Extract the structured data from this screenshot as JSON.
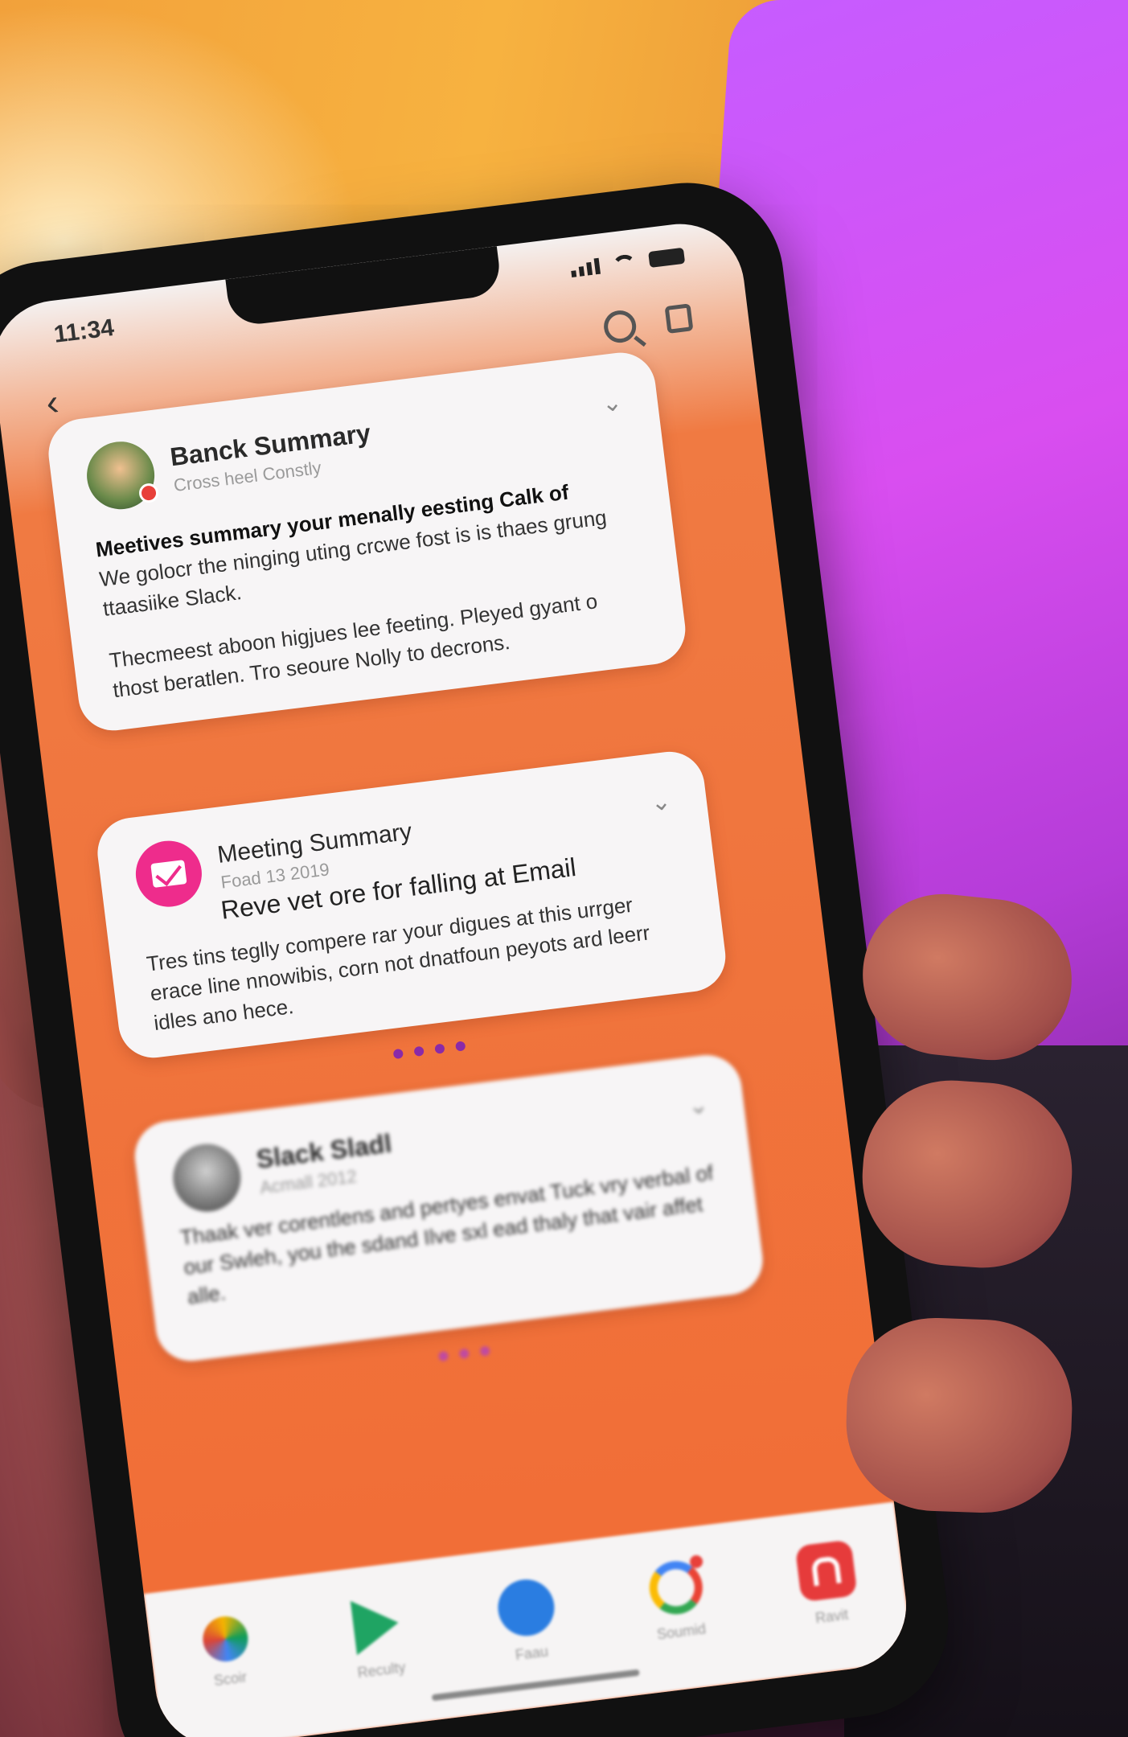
{
  "status_bar": {
    "time": "11:34"
  },
  "cards": [
    {
      "title": "Banck Summary",
      "subtitle": "Cross heel Constly",
      "body_bold": "Meetives summary your menally eesting Calk of",
      "body_lines_1": "We golocr the ninging uting crcwe fost is is thaes grung ttaasiike Slack.",
      "body_lines_2": "Thecmeest aboon higjues lee feeting. Pleyed gyant o thost beratlen. Tro seoure Nolly to decrons."
    },
    {
      "title": "Meeting Summary",
      "subtitle": "Foad 13 2019",
      "subject": "Reve vet ore for falling at Email",
      "body": "Tres tins teglly compere rar your digues at this urrger erace line nnowibis, corn not dnatfoun peyots ard leerr idles ano hece."
    },
    {
      "title": "Slack Sladl",
      "subtitle": "Acmall 2012",
      "body": "Thaak ver corentlens and pertyes envat Tuck vry verbal of our Swleh, you the sdand Ilve sxl ead thaly that vair affet alle."
    }
  ],
  "dock": [
    {
      "icon": "photos-icon",
      "label": "Scoir"
    },
    {
      "icon": "play-store-icon",
      "label": "Reculty"
    },
    {
      "icon": "people-icon",
      "label": "Faau"
    },
    {
      "icon": "google-icon",
      "label": "Soumid"
    },
    {
      "icon": "app-icon",
      "label": "Ravit"
    }
  ]
}
